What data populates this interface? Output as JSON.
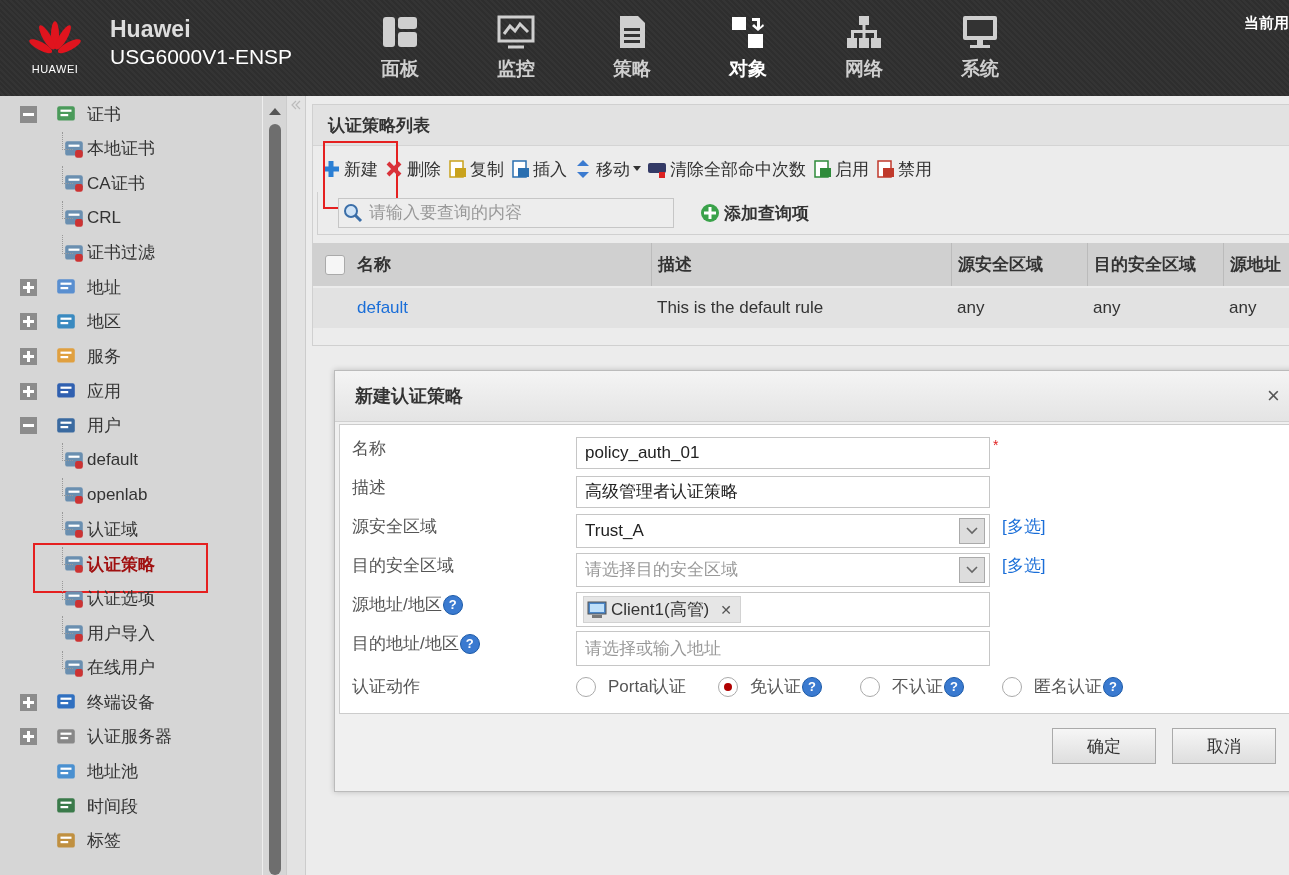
{
  "header": {
    "brand": "HUAWEI",
    "title": "Huawei",
    "device": "USG6000V1-ENSP",
    "user": "当前用",
    "nav": [
      {
        "label": "面板",
        "selected": false
      },
      {
        "label": "监控",
        "selected": false
      },
      {
        "label": "策略",
        "selected": false
      },
      {
        "label": "对象",
        "selected": true
      },
      {
        "label": "网络",
        "selected": false
      },
      {
        "label": "系统",
        "selected": false
      }
    ]
  },
  "sidebar": {
    "items": [
      {
        "label": "证书",
        "expanded": true,
        "children": [
          {
            "label": "本地证书",
            "selected": false,
            "highlighted": false
          },
          {
            "label": "CA证书",
            "selected": false,
            "highlighted": false
          },
          {
            "label": "CRL",
            "selected": false,
            "highlighted": false
          },
          {
            "label": "证书过滤",
            "selected": false,
            "highlighted": false
          }
        ]
      },
      {
        "label": "地址",
        "expanded": false
      },
      {
        "label": "地区",
        "expanded": false
      },
      {
        "label": "服务",
        "expanded": false
      },
      {
        "label": "应用",
        "expanded": false
      },
      {
        "label": "用户",
        "expanded": true,
        "children": [
          {
            "label": "default",
            "selected": false,
            "highlighted": false
          },
          {
            "label": "openlab",
            "selected": false,
            "highlighted": false
          },
          {
            "label": "认证域",
            "selected": false,
            "highlighted": false
          },
          {
            "label": "认证策略",
            "selected": true,
            "highlighted": true
          },
          {
            "label": "认证选项",
            "selected": false,
            "highlighted": false
          },
          {
            "label": "用户导入",
            "selected": false,
            "highlighted": false
          },
          {
            "label": "在线用户",
            "selected": false,
            "highlighted": false
          }
        ]
      },
      {
        "label": "终端设备",
        "expanded": false
      },
      {
        "label": "认证服务器",
        "expanded": false
      },
      {
        "label": "地址池"
      },
      {
        "label": "时间段"
      },
      {
        "label": "标签"
      }
    ]
  },
  "panel": {
    "title": "认证策略列表",
    "toolbar": [
      {
        "label": "新建",
        "highlighted": true
      },
      {
        "label": "删除",
        "highlighted": false
      },
      {
        "label": "复制",
        "highlighted": false
      },
      {
        "label": "插入",
        "highlighted": false
      },
      {
        "label": "移动",
        "highlighted": false
      },
      {
        "label": "清除全部命中次数",
        "highlighted": false
      },
      {
        "label": "启用",
        "highlighted": false
      },
      {
        "label": "禁用",
        "highlighted": false
      }
    ],
    "search": {
      "placeholder": "请输入要查询的内容"
    },
    "add_query": "添加查询项",
    "table": {
      "columns": [
        "名称",
        "描述",
        "源安全区域",
        "目的安全区域",
        "源地址"
      ],
      "select_all_checked": false,
      "rows": [
        {
          "cells": [
            "default",
            "This is the default rule",
            "any",
            "any",
            "any"
          ]
        }
      ]
    }
  },
  "dialog": {
    "title": "新建认证策略",
    "close": "×",
    "fields": [
      {
        "kind": "text",
        "label": "名称",
        "value": "policy_auth_01",
        "required": "*"
      },
      {
        "kind": "text",
        "label": "描述",
        "value": "高级管理者认证策略"
      },
      {
        "kind": "select",
        "label": "源安全区域",
        "value": "Trust_A",
        "link": "[多选]"
      },
      {
        "kind": "select",
        "label": "目的安全区域",
        "placeholder": "请选择目的安全区域",
        "link": "[多选]"
      },
      {
        "kind": "tags",
        "label": "源地址/地区",
        "help": "?",
        "tags": [
          {
            "label": "Client1(高管)",
            "remove": "✕"
          }
        ]
      },
      {
        "kind": "text",
        "label": "目的地址/地区",
        "help": "?",
        "placeholder": "请选择或输入地址"
      },
      {
        "kind": "radio",
        "label": "认证动作",
        "options": [
          {
            "label": "Portal认证",
            "selected": false
          },
          {
            "label": "免认证",
            "selected": true,
            "help": "?"
          },
          {
            "label": "不认证",
            "selected": false,
            "help": "?"
          },
          {
            "label": "匿名认证",
            "selected": false,
            "help": "?"
          }
        ]
      }
    ],
    "buttons": [
      "确定",
      "取消"
    ]
  }
}
